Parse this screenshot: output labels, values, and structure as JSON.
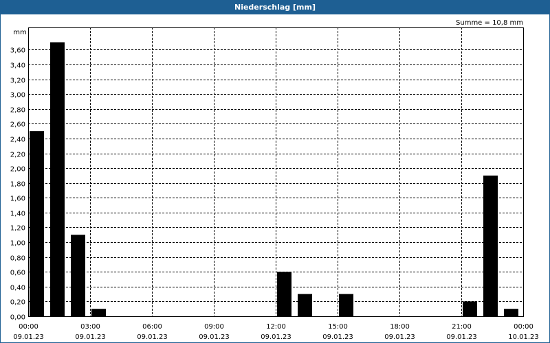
{
  "window": {
    "title": "Niederschlag [mm]"
  },
  "chart_data": {
    "type": "bar",
    "title": "Niederschlag [mm]",
    "ylabel": "mm",
    "sum_label": "Summe = 10,8 mm",
    "ylim": [
      0,
      3.9
    ],
    "xlim_hours": [
      0,
      24
    ],
    "bar_color": "#000000",
    "grid": true,
    "y_ticks": [
      {
        "value": 0.0,
        "label": "0,00"
      },
      {
        "value": 0.2,
        "label": "0,20"
      },
      {
        "value": 0.4,
        "label": "0,40"
      },
      {
        "value": 0.6,
        "label": "0,60"
      },
      {
        "value": 0.8,
        "label": "0,80"
      },
      {
        "value": 1.0,
        "label": "1,00"
      },
      {
        "value": 1.2,
        "label": "1,20"
      },
      {
        "value": 1.4,
        "label": "1,40"
      },
      {
        "value": 1.6,
        "label": "1,60"
      },
      {
        "value": 1.8,
        "label": "1,80"
      },
      {
        "value": 2.0,
        "label": "2,00"
      },
      {
        "value": 2.2,
        "label": "2,20"
      },
      {
        "value": 2.4,
        "label": "2,40"
      },
      {
        "value": 2.6,
        "label": "2,60"
      },
      {
        "value": 2.8,
        "label": "2,80"
      },
      {
        "value": 3.0,
        "label": "3,00"
      },
      {
        "value": 3.2,
        "label": "3,20"
      },
      {
        "value": 3.4,
        "label": "3,40"
      },
      {
        "value": 3.6,
        "label": "3,60"
      }
    ],
    "x_ticks": [
      {
        "hour": 0,
        "time": "00:00",
        "date": "09.01.23"
      },
      {
        "hour": 3,
        "time": "03:00",
        "date": "09.01.23"
      },
      {
        "hour": 6,
        "time": "06:00",
        "date": "09.01.23"
      },
      {
        "hour": 9,
        "time": "09:00",
        "date": "09.01.23"
      },
      {
        "hour": 12,
        "time": "12:00",
        "date": "09.01.23"
      },
      {
        "hour": 15,
        "time": "15:00",
        "date": "09.01.23"
      },
      {
        "hour": 18,
        "time": "18:00",
        "date": "09.01.23"
      },
      {
        "hour": 21,
        "time": "21:00",
        "date": "09.01.23"
      },
      {
        "hour": 24,
        "time": "00:00",
        "date": "10.01.23"
      }
    ],
    "bar_width_hours": 0.7,
    "bars": [
      {
        "hour": 0.0,
        "value": 2.5
      },
      {
        "hour": 1.0,
        "value": 3.7
      },
      {
        "hour": 2.0,
        "value": 1.1
      },
      {
        "hour": 3.0,
        "value": 0.1
      },
      {
        "hour": 12.0,
        "value": 0.6
      },
      {
        "hour": 13.0,
        "value": 0.3
      },
      {
        "hour": 15.0,
        "value": 0.3
      },
      {
        "hour": 21.0,
        "value": 0.2
      },
      {
        "hour": 22.0,
        "value": 1.9
      },
      {
        "hour": 23.0,
        "value": 0.1
      }
    ]
  }
}
